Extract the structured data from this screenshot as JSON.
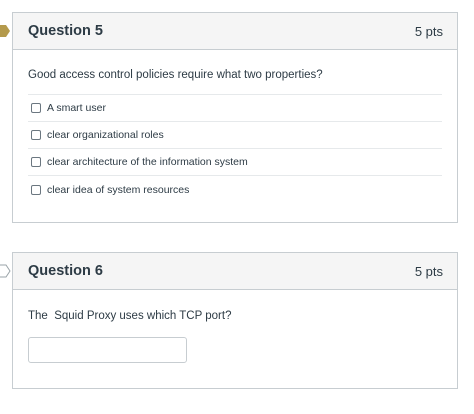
{
  "questions": [
    {
      "title": "Question 5",
      "points": "5 pts",
      "text": "Good access control policies require what two properties?",
      "flag_icon": "flag-marker-icon",
      "flag_color": "#b49a4c",
      "answers": [
        {
          "label": "A smart user",
          "checked": false
        },
        {
          "label": "clear organizational roles",
          "checked": false
        },
        {
          "label": "clear architecture of the information system",
          "checked": false
        },
        {
          "label": "clear idea of system resources",
          "checked": false
        }
      ]
    },
    {
      "title": "Question 6",
      "points": "5 pts",
      "text": "The  Squid Proxy uses which TCP port?",
      "flag_icon": "flag-marker-outline-icon",
      "flag_color": "#9aa3a8",
      "answer_value": "",
      "answer_placeholder": ""
    }
  ],
  "colors": {
    "header_bg": "#f5f5f5",
    "border": "#c7cdd1",
    "text": "#2d3b45"
  }
}
